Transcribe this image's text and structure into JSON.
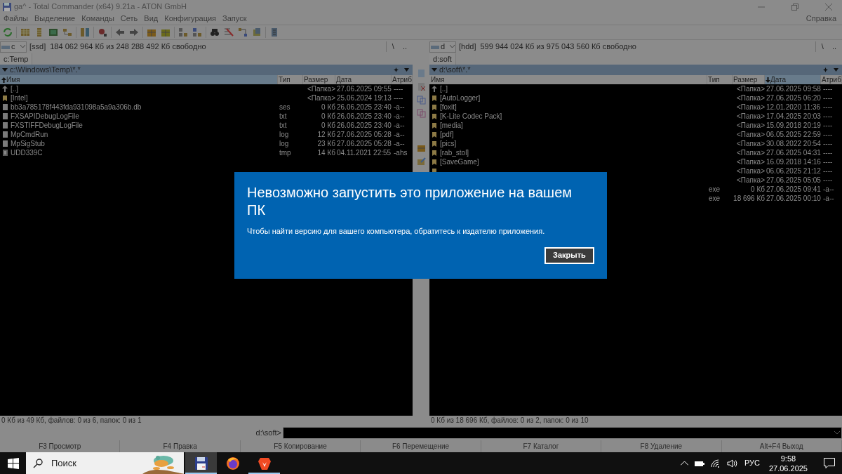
{
  "window": {
    "title": "ga^ - Total Commander (x64) 9.21a - ATON GmbH"
  },
  "menu": [
    "Файлы",
    "Выделение",
    "Команды",
    "Сеть",
    "Вид",
    "Конфигурация",
    "Запуск"
  ],
  "help_menu": "Справка",
  "panels": [
    {
      "drive": "c",
      "drive_label": "[ssd]",
      "free_space": "184 062 964 Кб из 248 288 492 Кб свободно",
      "root_button": "\\",
      "up_button": "..",
      "tab": "c:Temp",
      "path": "c:\\Windows\\Temp\\*.*",
      "columns": [
        {
          "label": "Имя",
          "sorted": true,
          "descending": false
        },
        {
          "label": "Тип",
          "sorted": false
        },
        {
          "label": "Размер",
          "sorted": false
        },
        {
          "label": "Дата",
          "sorted": false
        },
        {
          "label": "Атриб",
          "sorted": false
        }
      ],
      "rows": [
        {
          "kind": "up",
          "name": "[..]",
          "size": "<Папка>",
          "date": "27.06.2025 09:55",
          "attr": "----"
        },
        {
          "kind": "folder",
          "name": "[Intel]",
          "size": "<Папка>",
          "date": "25.06.2024 19:13",
          "attr": "----"
        },
        {
          "kind": "file",
          "name": "bb3a785178f443fda931098a5a9a306b.db",
          "type": "ses",
          "size": "0 Кб",
          "date": "26.06.2025 23:40",
          "attr": "-a--"
        },
        {
          "kind": "file",
          "name": "FXSAPIDebugLogFile",
          "type": "txt",
          "size": "0 Кб",
          "date": "26.06.2025 23:40",
          "attr": "-a--"
        },
        {
          "kind": "file",
          "name": "FXSTIFFDebugLogFile",
          "type": "txt",
          "size": "0 Кб",
          "date": "26.06.2025 23:40",
          "attr": "-a--"
        },
        {
          "kind": "file",
          "name": "MpCmdRun",
          "type": "log",
          "size": "12 Кб",
          "date": "27.06.2025 05:28",
          "attr": "-a--"
        },
        {
          "kind": "file",
          "name": "MpSigStub",
          "type": "log",
          "size": "23 Кб",
          "date": "27.06.2025 05:28",
          "attr": "-a--"
        },
        {
          "kind": "system",
          "name": "UDD339C",
          "type": "tmp",
          "size": "14 Кб",
          "date": "04.11.2021 22:55",
          "attr": "-ahs"
        }
      ],
      "status": "0 Кб из 49 Кб, файлов: 0 из 6, папок: 0 из 1"
    },
    {
      "drive": "d",
      "drive_label": "[hdd]",
      "free_space": "599 944 024 Кб из 975 043 560 Кб свободно",
      "root_button": "\\",
      "up_button": "..",
      "tab": "d:soft",
      "path": "d:\\soft\\*.*",
      "columns": [
        {
          "label": "Имя",
          "sorted": false
        },
        {
          "label": "Тип",
          "sorted": false
        },
        {
          "label": "Размер",
          "sorted": false
        },
        {
          "label": "Дата",
          "sorted": true,
          "descending": true
        },
        {
          "label": "Атриб",
          "sorted": false
        }
      ],
      "rows": [
        {
          "kind": "up",
          "name": "[..]",
          "size": "<Папка>",
          "date": "27.06.2025 09:58",
          "attr": "----"
        },
        {
          "kind": "folder",
          "name": "[AutoLogger]",
          "size": "<Папка>",
          "date": "27.06.2025 06:20",
          "attr": "----"
        },
        {
          "kind": "folder",
          "name": "[foxit]",
          "size": "<Папка>",
          "date": "12.01.2020 11:36",
          "attr": "----"
        },
        {
          "kind": "folder",
          "name": "[K-Lite Codec Pack]",
          "size": "<Папка>",
          "date": "17.04.2025 20:03",
          "attr": "----"
        },
        {
          "kind": "folder",
          "name": "[media]",
          "size": "<Папка>",
          "date": "15.09.2018 20:19",
          "attr": "----"
        },
        {
          "kind": "folder",
          "name": "[pdf]",
          "size": "<Папка>",
          "date": "06.05.2025 22:59",
          "attr": "----"
        },
        {
          "kind": "folder",
          "name": "[pics]",
          "size": "<Папка>",
          "date": "30.08.2022 20:54",
          "attr": "----"
        },
        {
          "kind": "folder",
          "name": "[rab_stol]",
          "size": "<Папка>",
          "date": "27.06.2025 04:31",
          "attr": "----"
        },
        {
          "kind": "folder",
          "name": "[SaveGame]",
          "size": "<Папка>",
          "date": "16.09.2018 14:16",
          "attr": "----"
        },
        {
          "kind": "folder",
          "size": "<Папка>",
          "date": "06.06.2025 21:12",
          "attr": "----"
        },
        {
          "size": "<Папка>",
          "date": "27.06.2025 05:05",
          "attr": "----"
        },
        {
          "type": "exe",
          "size": "0 Кб",
          "date": "27.06.2025 09:41",
          "attr": "-a--"
        },
        {
          "type": "exe",
          "size": "18 696 Кб",
          "date": "27.06.2025 00:10",
          "attr": "-a--"
        }
      ],
      "status": "0 Кб из 18 696 Кб, файлов: 0 из 2, папок: 0 из 10"
    }
  ],
  "command": {
    "prompt": "d:\\soft>"
  },
  "fkeys": [
    "F3 Просмотр",
    "F4 Правка",
    "F5 Копирование",
    "F6 Перемещение",
    "F7 Каталог",
    "F8 Удаление",
    "Alt+F4 Выход"
  ],
  "dialog": {
    "title": "Невозможно запустить это приложение на вашем ПК",
    "message": "Чтобы найти версию для вашего компьютера, обратитесь к издателю приложения.",
    "button": "Закрыть"
  },
  "taskbar": {
    "search_placeholder": "Поиск",
    "apps": [
      {
        "kind": "floppy",
        "running": true,
        "selected": true
      },
      {
        "kind": "firefox",
        "running": false,
        "selected": false
      },
      {
        "kind": "brave",
        "running": true,
        "selected": false
      }
    ],
    "language": "РУС",
    "time": "9:58",
    "date": "27.06.2025"
  }
}
